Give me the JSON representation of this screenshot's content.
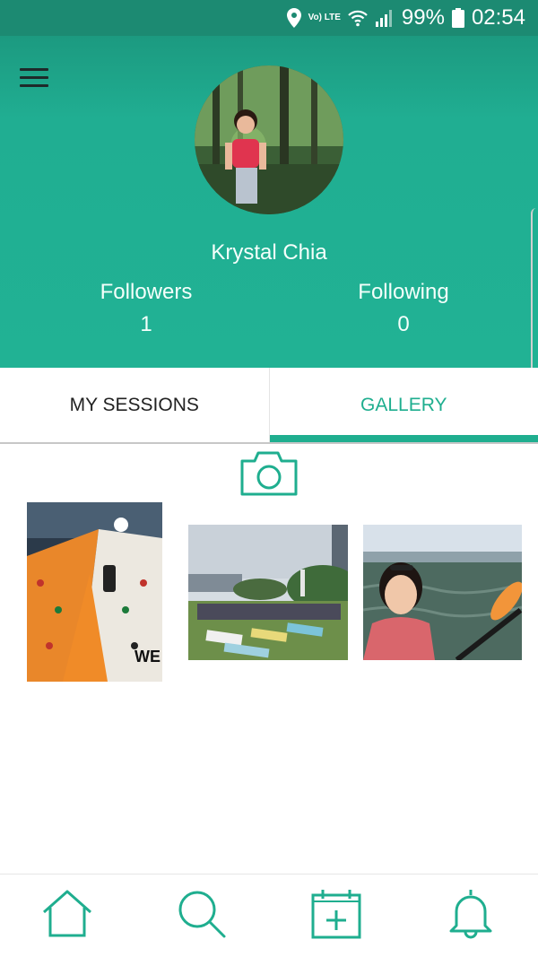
{
  "status_bar": {
    "battery_text": "99%",
    "time": "02:54",
    "network_label": "Vo) LTE",
    "icons": [
      "location-icon",
      "lte-icon",
      "wifi-icon",
      "signal-icon",
      "battery-icon"
    ]
  },
  "profile": {
    "name": "Krystal Chia",
    "followers_label": "Followers",
    "followers_count": "1",
    "following_label": "Following",
    "following_count": "0"
  },
  "tabs": [
    {
      "label": "MY SESSIONS",
      "active": false
    },
    {
      "label": "GALLERY",
      "active": true
    }
  ],
  "gallery": {
    "camera_icon": "camera-icon",
    "photos": [
      "climbing-wall-photo",
      "outdoor-yoga-photo",
      "kayak-selfie-photo"
    ]
  },
  "bottom_nav": [
    "home-icon",
    "search-icon",
    "calendar-add-icon",
    "bell-icon"
  ],
  "colors": {
    "accent": "#1fae8f",
    "header": "#21b294",
    "status_bar": "#1c8a72"
  }
}
